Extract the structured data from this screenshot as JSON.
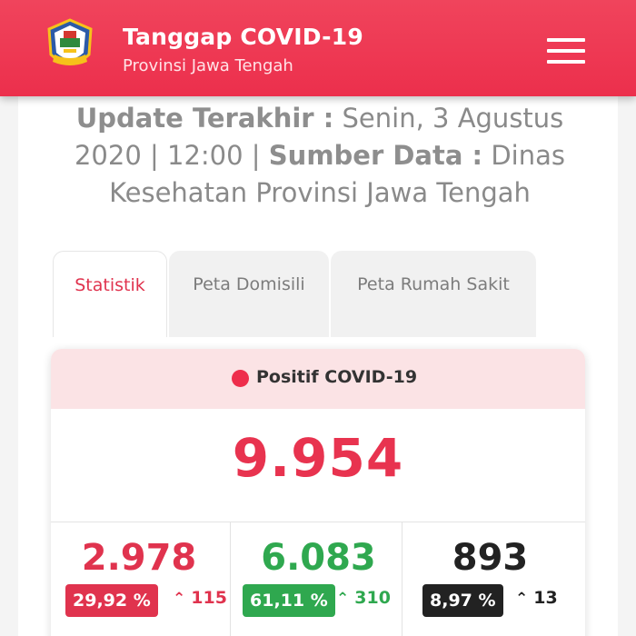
{
  "header": {
    "title": "Tanggap COVID-19",
    "subtitle": "Provinsi Jawa Tengah",
    "logo_icon": "jawa-tengah-emblem-icon",
    "menu_icon": "hamburger-menu-icon"
  },
  "update": {
    "label_update": "Update Terakhir :",
    "date": "Senin, 3 Agustus 2020 | 12:00 |",
    "label_source": "Sumber Data :",
    "source": "Dinas Kesehatan Provinsi Jawa Tengah"
  },
  "tabs": [
    {
      "label": "Statistik",
      "active": true
    },
    {
      "label": "Peta Domisili",
      "active": false
    },
    {
      "label": "Peta Rumah Sakit",
      "active": false
    }
  ],
  "stats": {
    "title": "Positif COVID-19",
    "total": "9.954",
    "columns": [
      {
        "value": "2.978",
        "percent": "29,92 %",
        "delta": "115",
        "color": "#e0334e",
        "badge_color": "#e0334e"
      },
      {
        "value": "6.083",
        "percent": "61,11 %",
        "delta": "310",
        "color": "#2fa84f",
        "badge_color": "#2fa84f"
      },
      {
        "value": "893",
        "percent": "8,97 %",
        "delta": "13",
        "color": "#222222",
        "badge_color": "#222222"
      }
    ]
  },
  "colors": {
    "header": "#ec2f4c",
    "accent": "#e8334f",
    "stats_header_bg": "#fbe3e5"
  }
}
